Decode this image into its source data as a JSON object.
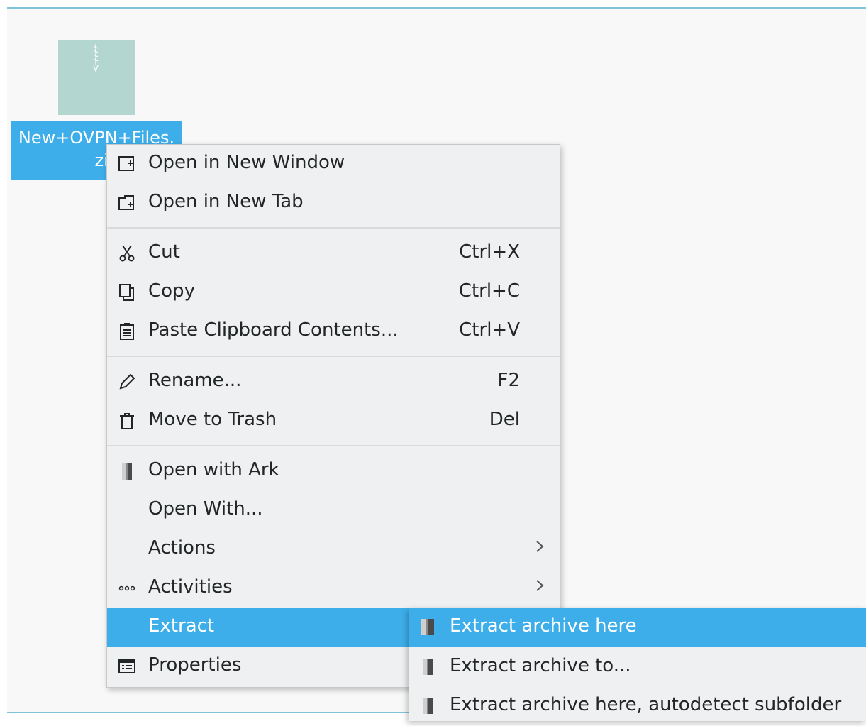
{
  "desktop": {
    "file": {
      "name_line1": "New+OVPN+Files.",
      "name_line2": "zip",
      "icon": "zip-archive-icon"
    }
  },
  "context_menu": {
    "items": [
      {
        "label": "Open in New Window",
        "icon": "new-window-icon"
      },
      {
        "label": "Open in New Tab",
        "icon": "new-tab-icon"
      },
      {
        "label": "Cut",
        "shortcut": "Ctrl+X",
        "icon": "scissors-icon"
      },
      {
        "label": "Copy",
        "shortcut": "Ctrl+C",
        "icon": "copy-icon"
      },
      {
        "label": "Paste Clipboard Contents...",
        "shortcut": "Ctrl+V",
        "icon": "clipboard-icon"
      },
      {
        "label": "Rename...",
        "shortcut": "F2",
        "icon": "pencil-icon"
      },
      {
        "label": "Move to Trash",
        "shortcut": "Del",
        "icon": "trash-icon"
      },
      {
        "label": "Open with Ark",
        "icon": "ark-icon"
      },
      {
        "label": "Open With..."
      },
      {
        "label": "Actions",
        "icon": "chevron-right-icon"
      },
      {
        "label": "Activities",
        "icon": "activities-icon"
      },
      {
        "label": "Extract",
        "active": true
      },
      {
        "label": "Properties",
        "icon": "properties-icon"
      }
    ]
  },
  "submenu": {
    "items": [
      {
        "label": "Extract archive here",
        "active": true,
        "icon": "ark-icon"
      },
      {
        "label": "Extract archive to...",
        "icon": "ark-icon"
      },
      {
        "label": "Extract archive here, autodetect subfolder",
        "icon": "ark-icon"
      }
    ]
  },
  "colors": {
    "highlight": "#3daee9",
    "menu_bg": "#eff0f1",
    "text": "#232627"
  }
}
